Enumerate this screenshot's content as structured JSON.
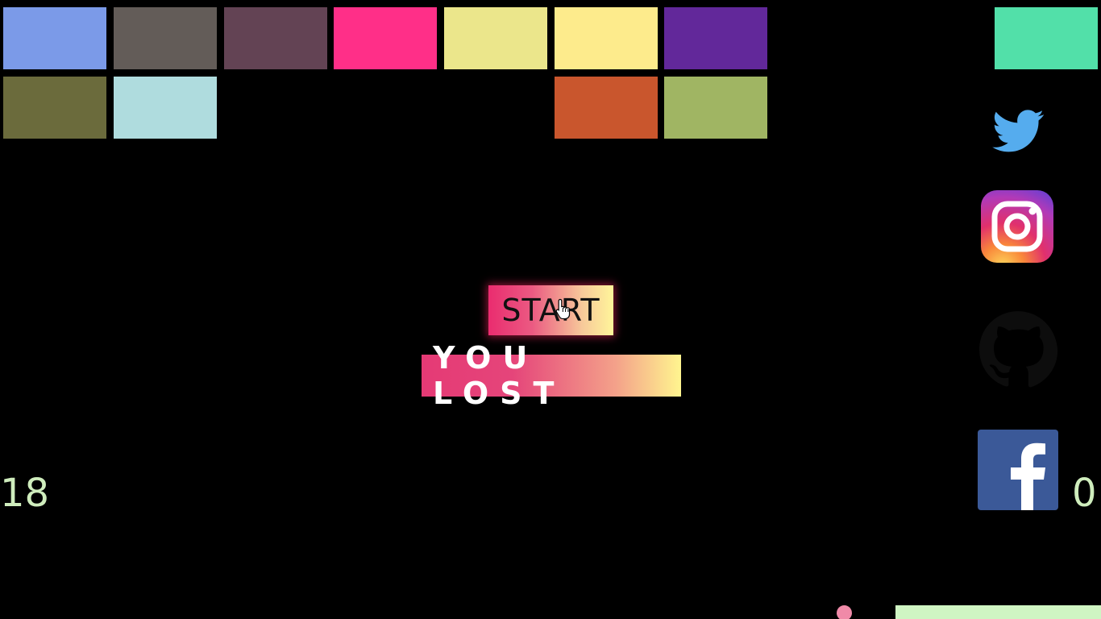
{
  "bricks": [
    {
      "row": 0,
      "col": 0,
      "color": "#7b9ae8"
    },
    {
      "row": 0,
      "col": 1,
      "color": "#635c58"
    },
    {
      "row": 0,
      "col": 2,
      "color": "#634354"
    },
    {
      "row": 0,
      "col": 3,
      "color": "#ff2f88"
    },
    {
      "row": 0,
      "col": 4,
      "color": "#ebe68b"
    },
    {
      "row": 0,
      "col": 5,
      "color": "#fdeb8c"
    },
    {
      "row": 0,
      "col": 6,
      "color": "#62289a"
    },
    {
      "row": 0,
      "col": 9,
      "color": "#52e0a9"
    },
    {
      "row": 1,
      "col": 0,
      "color": "#6b6b3c"
    },
    {
      "row": 1,
      "col": 1,
      "color": "#afdcde"
    },
    {
      "row": 1,
      "col": 5,
      "color": "#c9562d"
    },
    {
      "row": 1,
      "col": 6,
      "color": "#a0b563"
    }
  ],
  "overlay": {
    "start_label": "START",
    "status_message": "YOU LOST"
  },
  "score": {
    "left": "18",
    "right": "0"
  },
  "social": [
    {
      "name": "twitter-icon",
      "color": "#55acee"
    },
    {
      "name": "instagram-icon",
      "color": "#e1306c"
    },
    {
      "name": "github-icon",
      "color": "#0d0d0d"
    },
    {
      "name": "facebook-icon",
      "color": "#3b5998"
    }
  ],
  "colors": {
    "background": "#000000",
    "score_text": "#cfedbd",
    "ball": "#f08aa8",
    "paddle": "#cff5c3"
  }
}
